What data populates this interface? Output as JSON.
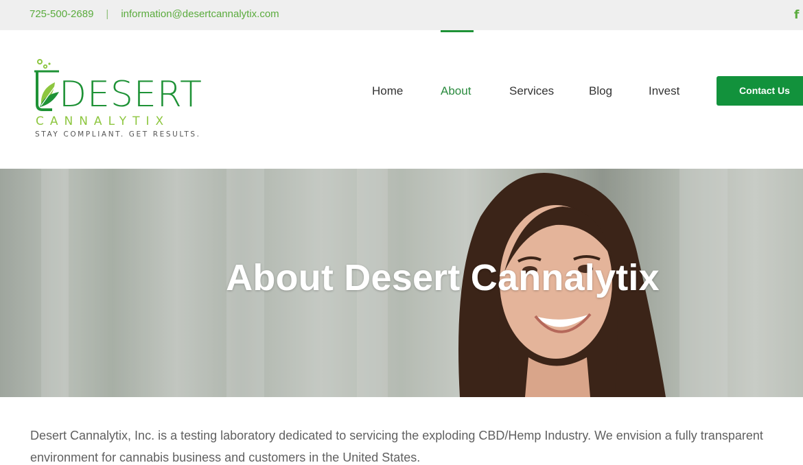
{
  "topbar": {
    "phone": "725-500-2689",
    "separator": "|",
    "email": "information@desertcannalytix.com",
    "social_icon": "facebook-icon",
    "social_glyph": "f"
  },
  "logo": {
    "word": "DESERT",
    "sub": "CANNALYTIX",
    "tagline": "STAY COMPLIANT. GET RESULTS."
  },
  "nav": {
    "items": [
      {
        "label": "Home"
      },
      {
        "label": "About"
      },
      {
        "label": "Services"
      },
      {
        "label": "Blog"
      },
      {
        "label": "Invest"
      }
    ],
    "active": "About",
    "cta_label": "Contact Us"
  },
  "hero": {
    "title": "About Desert Cannalytix"
  },
  "intro": {
    "text": "Desert Cannalytix, Inc. is a testing laboratory dedicated to servicing the exploding CBD/Hemp Industry. We envision a fully transparent environment for cannabis business and customers in the United States."
  },
  "colors": {
    "brand_green": "#1e9236",
    "light_green": "#8dc63f",
    "link_green": "#5aab3d",
    "button_green": "#12923c"
  }
}
